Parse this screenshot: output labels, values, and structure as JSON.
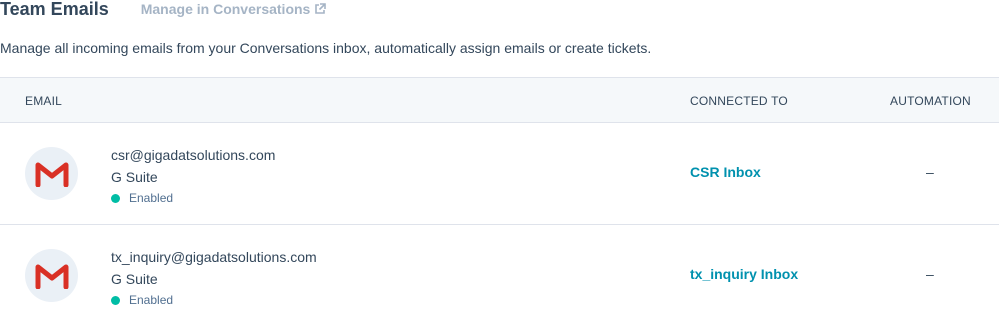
{
  "header": {
    "title": "Team Emails",
    "manage_link": "Manage in Conversations"
  },
  "description": "Manage all incoming emails from your Conversations inbox, automatically assign emails or create tickets.",
  "table": {
    "columns": {
      "email": "EMAIL",
      "connected_to": "CONNECTED TO",
      "automation": "AUTOMATION"
    },
    "rows": [
      {
        "email": "csr@gigadatsolutions.com",
        "provider": "G Suite",
        "status": "Enabled",
        "connected_to": "CSR Inbox",
        "automation": "–",
        "icon": "gmail-icon"
      },
      {
        "email": "tx_inquiry@gigadatsolutions.com",
        "provider": "G Suite",
        "status": "Enabled",
        "connected_to": "tx_inquiry Inbox",
        "automation": "–",
        "icon": "gmail-icon"
      }
    ]
  },
  "colors": {
    "link": "#0091ae",
    "muted_link": "#a5b4c5",
    "enabled_dot": "#00bda5",
    "header_bg": "#f5f8fa",
    "gmail_red": "#d93025"
  }
}
